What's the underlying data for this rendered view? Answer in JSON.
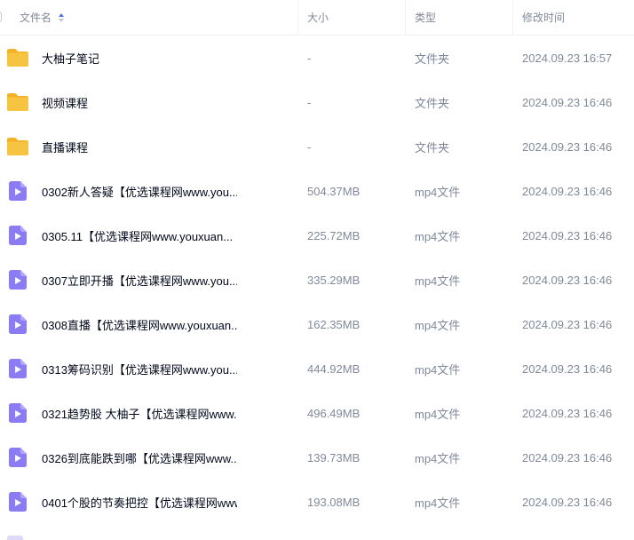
{
  "columns": {
    "name": "文件名",
    "size": "大小",
    "type": "类型",
    "modified": "修改时间"
  },
  "colors": {
    "folder": "#f7c442",
    "folder_tab": "#f2b126",
    "video": "#8c7cf3",
    "sort_active": "#4e6ef2"
  },
  "rows": [
    {
      "icon": "folder-icon",
      "name": "大柚子笔记",
      "size": "-",
      "type": "文件夹",
      "modified": "2024.09.23 16:57"
    },
    {
      "icon": "folder-icon",
      "name": "视频课程",
      "size": "-",
      "type": "文件夹",
      "modified": "2024.09.23 16:46"
    },
    {
      "icon": "folder-icon",
      "name": "直播课程",
      "size": "-",
      "type": "文件夹",
      "modified": "2024.09.23 16:46"
    },
    {
      "icon": "video-file-icon",
      "name": "0302新人答疑【优选课程网www.you...",
      "size": "504.37MB",
      "type": "mp4文件",
      "modified": "2024.09.23 16:46"
    },
    {
      "icon": "video-file-icon",
      "name": "0305.11【优选课程网www.youxuan...",
      "size": "225.72MB",
      "type": "mp4文件",
      "modified": "2024.09.23 16:46"
    },
    {
      "icon": "video-file-icon",
      "name": "0307立即开播【优选课程网www.you...",
      "size": "335.29MB",
      "type": "mp4文件",
      "modified": "2024.09.23 16:46"
    },
    {
      "icon": "video-file-icon",
      "name": "0308直播【优选课程网www.youxuan...",
      "size": "162.35MB",
      "type": "mp4文件",
      "modified": "2024.09.23 16:46"
    },
    {
      "icon": "video-file-icon",
      "name": "0313筹码识别【优选课程网www.you...",
      "size": "444.92MB",
      "type": "mp4文件",
      "modified": "2024.09.23 16:46"
    },
    {
      "icon": "video-file-icon",
      "name": "0321趋势股 大柚子【优选课程网www....",
      "size": "496.49MB",
      "type": "mp4文件",
      "modified": "2024.09.23 16:46"
    },
    {
      "icon": "video-file-icon",
      "name": "0326到底能跌到哪【优选课程网www....",
      "size": "139.73MB",
      "type": "mp4文件",
      "modified": "2024.09.23 16:46"
    },
    {
      "icon": "video-file-icon",
      "name": "0401个股的节奏把控【优选课程网www....",
      "size": "193.08MB",
      "type": "mp4文件",
      "modified": "2024.09.23 16:46"
    }
  ]
}
